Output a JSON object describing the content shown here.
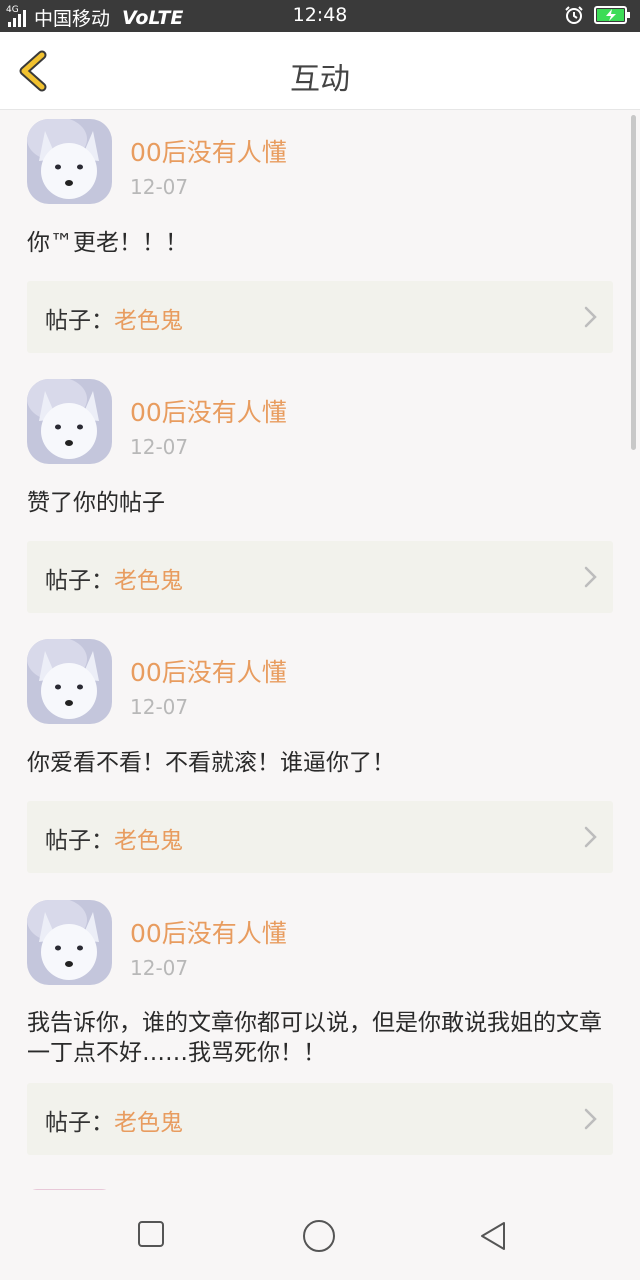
{
  "status_bar": {
    "network_badge": "4G",
    "carrier": "中国移动",
    "volte": "VoLTE",
    "time": "12:48",
    "alarm_icon": "alarm-clock-icon",
    "battery_icon": "battery-charging-icon",
    "battery_color": "#3ddc57"
  },
  "header": {
    "back_icon": "chevron-left-icon",
    "back_color": "#f2c230",
    "title": "互动"
  },
  "colors": {
    "username": "#e89c5f",
    "post_title": "#e89c5f",
    "card_bg": "#f2f2ec"
  },
  "items": [
    {
      "username": "00后没有人懂",
      "date": "12-07",
      "comment": "你™更老！！！",
      "post_prefix": "帖子：",
      "post_title": "老色鬼"
    },
    {
      "username": "00后没有人懂",
      "date": "12-07",
      "comment": "赞了你的帖子",
      "post_prefix": "帖子：",
      "post_title": "老色鬼"
    },
    {
      "username": "00后没有人懂",
      "date": "12-07",
      "comment": "你爱看不看！不看就滚！谁逼你了！",
      "post_prefix": "帖子：",
      "post_title": "老色鬼"
    },
    {
      "username": "00后没有人懂",
      "date": "12-07",
      "comment": "我告诉你，谁的文章你都可以说，但是你敢说我姐的文章一丁点不好……我骂死你！！",
      "post_prefix": "帖子：",
      "post_title": "老色鬼"
    }
  ],
  "nav_bar": {
    "recents_icon": "square-icon",
    "home_icon": "circle-icon",
    "back_icon": "triangle-back-icon"
  }
}
